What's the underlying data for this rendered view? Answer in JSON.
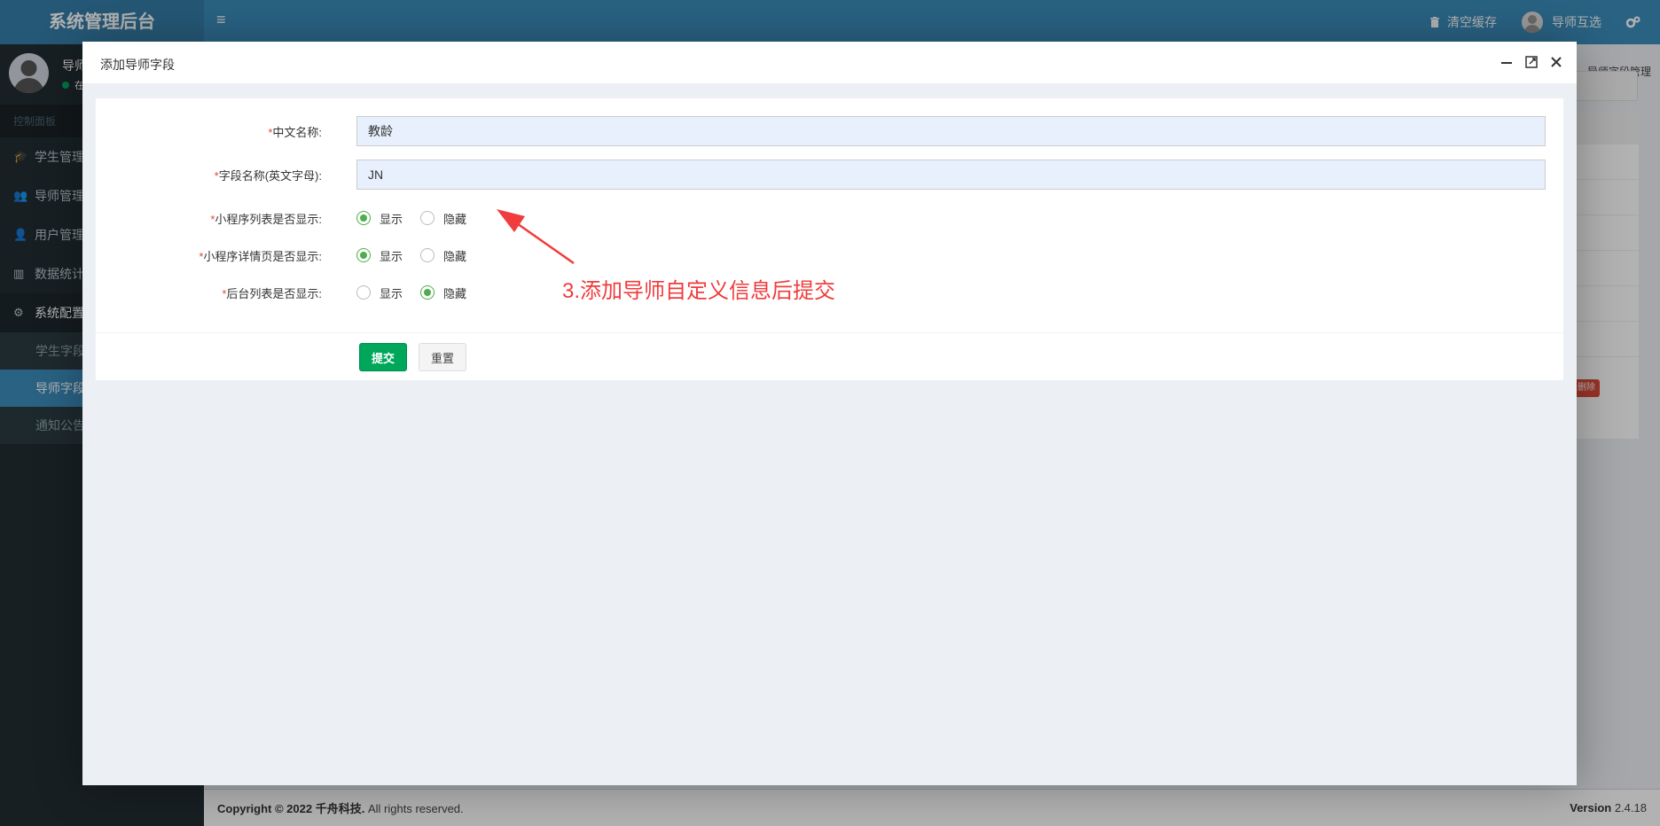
{
  "app": {
    "title": "系统管理后台",
    "clear_cache": "清空缓存",
    "username": "导师互选"
  },
  "sidebar": {
    "user_name": "导师",
    "user_status": "在",
    "menu_header": "控制面板",
    "items": [
      {
        "label": "学生管理",
        "icon": "graduation-cap-icon"
      },
      {
        "label": "导师管理",
        "icon": "users-icon"
      },
      {
        "label": "用户管理",
        "icon": "user-icon"
      },
      {
        "label": "数据统计",
        "icon": "bar-chart-icon"
      },
      {
        "label": "系统配置",
        "icon": "gears-icon"
      }
    ],
    "sub_items": [
      {
        "label": "学生字段"
      },
      {
        "label": "导师字段"
      },
      {
        "label": "通知公告"
      }
    ]
  },
  "breadcrumb": "导师字段管理",
  "background": {
    "delete_label": "删除"
  },
  "footer": {
    "copyright_prefix": "Copyright © 2022",
    "company": "千舟科技.",
    "rights": "All rights reserved.",
    "version_label": "Version",
    "version": "2.4.18"
  },
  "modal": {
    "title": "添加导师字段",
    "fields": {
      "cn_name": {
        "label": "中文名称:",
        "value": "教龄"
      },
      "field_name": {
        "label": "字段名称(英文字母):",
        "value": "JN"
      }
    },
    "radios": [
      {
        "label": "小程序列表是否显示:",
        "options": [
          "显示",
          "隐藏"
        ],
        "selected": 0
      },
      {
        "label": "小程序详情页是否显示:",
        "options": [
          "显示",
          "隐藏"
        ],
        "selected": 0
      },
      {
        "label": "后台列表是否显示:",
        "options": [
          "显示",
          "隐藏"
        ],
        "selected": 1
      }
    ],
    "required_mark": "*",
    "submit_label": "提交",
    "reset_label": "重置"
  },
  "annotation": {
    "text": "3.添加导师自定义信息后提交",
    "color": "#f03c3c"
  },
  "colors": {
    "primary": "#3c8dbc",
    "success": "#00a65a",
    "danger": "#dd4b39",
    "sidebar": "#222d32"
  }
}
